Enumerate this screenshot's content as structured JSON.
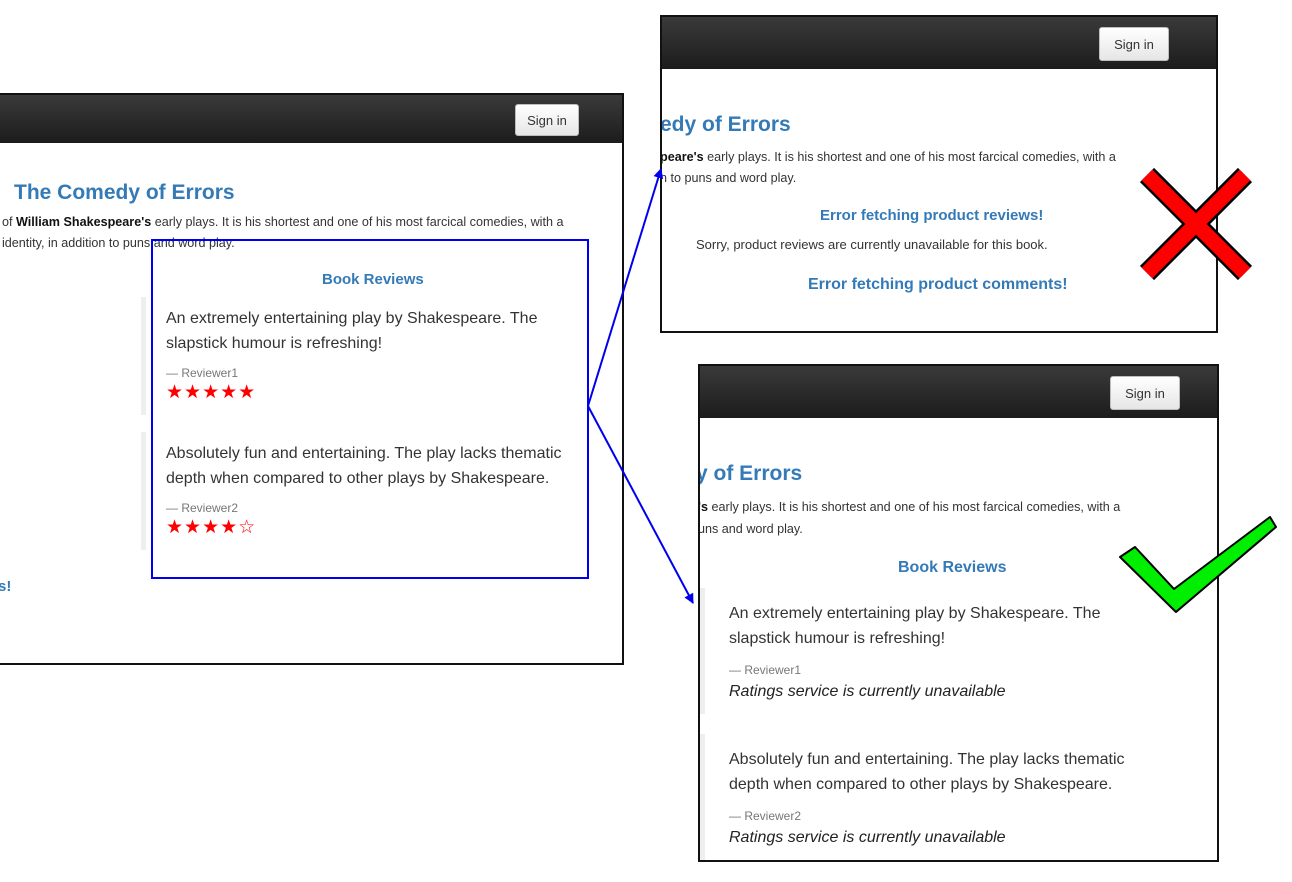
{
  "left_panel": {
    "signin_label": "Sign in",
    "title": "The Comedy of Errors",
    "summary_line1_prefix": "of ",
    "summary_line1_bold": "William Shakespeare's",
    "summary_line1_rest": " early plays. It is his shortest and one of his most farcical comedies, with a",
    "summary_line2": "identity, in addition to puns and word play.",
    "reviews_heading": "Book Reviews",
    "reviews": [
      {
        "text_line1": "An extremely entertaining play by Shakespeare. The",
        "text_line2": "slapstick humour is refreshing!",
        "author": "— Reviewer1",
        "stars": "★★★★★"
      },
      {
        "text_line1": "Absolutely fun and entertaining. The play lacks thematic",
        "text_line2": "depth when compared to other plays by Shakespeare.",
        "author": "— Reviewer2",
        "stars": "★★★★☆"
      }
    ],
    "fragment": "s!"
  },
  "top_right_panel": {
    "signin_label": "Sign in",
    "title": "edy of Errors",
    "summary_line1_bold": "peare's",
    "summary_line1_rest": " early plays. It is his shortest and one of his most farcical comedies, with a",
    "summary_line2": "n to puns and word play.",
    "reviews_error_heading": "Error fetching product reviews!",
    "reviews_error_text": "Sorry, product reviews are currently unavailable for this book.",
    "comments_error_heading": "Error fetching product comments!"
  },
  "bottom_right_panel": {
    "signin_label": "Sign in",
    "title": "y of Errors",
    "summary_line1_bold": "'s",
    "summary_line1_rest": " early plays. It is his shortest and one of his most farcical comedies, with a",
    "summary_line2": "uns and word play.",
    "reviews_heading": "Book Reviews",
    "reviews": [
      {
        "text_line1": "An extremely entertaining play by Shakespeare. The",
        "text_line2": "slapstick humour is refreshing!",
        "author": "— Reviewer1",
        "rating_text": "Ratings service is currently unavailable"
      },
      {
        "text_line1": "Absolutely fun and entertaining. The play lacks thematic",
        "text_line2": "depth when compared to other plays by Shakespeare.",
        "author": "— Reviewer2",
        "rating_text": "Ratings service is currently unavailable"
      }
    ]
  },
  "annotations": {
    "highlight_color": "#0000ee",
    "arrow_color": "#0000ee",
    "fail_mark_icon": "red-x-icon",
    "fail_color": "#ff0000",
    "pass_mark_icon": "green-check-icon",
    "pass_color": "#00ee00"
  }
}
